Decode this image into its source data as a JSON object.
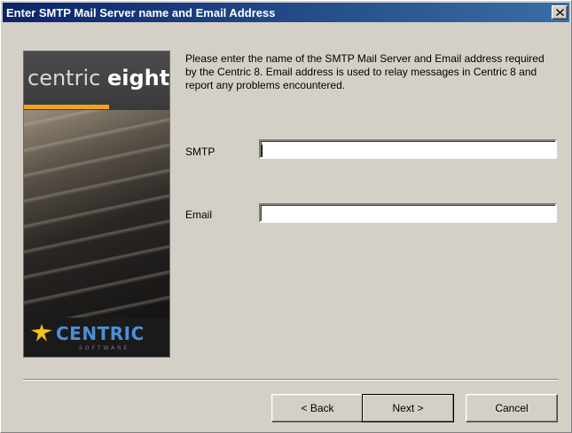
{
  "window": {
    "title": "Enter SMTP Mail Server name and Email Address"
  },
  "banner": {
    "product_light": "centric ",
    "product_bold": "eight",
    "company": "CENTRIC",
    "company_sub": "SOFTWARE",
    "accent_color": "#f2a31b",
    "brand_color": "#4a90d9"
  },
  "content": {
    "description": "Please enter the name of the SMTP Mail Server and Email address required by the Centric 8. Email address is used to relay messages in Centric 8 and report any problems encountered.",
    "smtp_label": "SMTP",
    "smtp_value": "",
    "email_label": "Email",
    "email_value": ""
  },
  "buttons": {
    "back": "< Back",
    "next": "Next >",
    "cancel": "Cancel"
  }
}
